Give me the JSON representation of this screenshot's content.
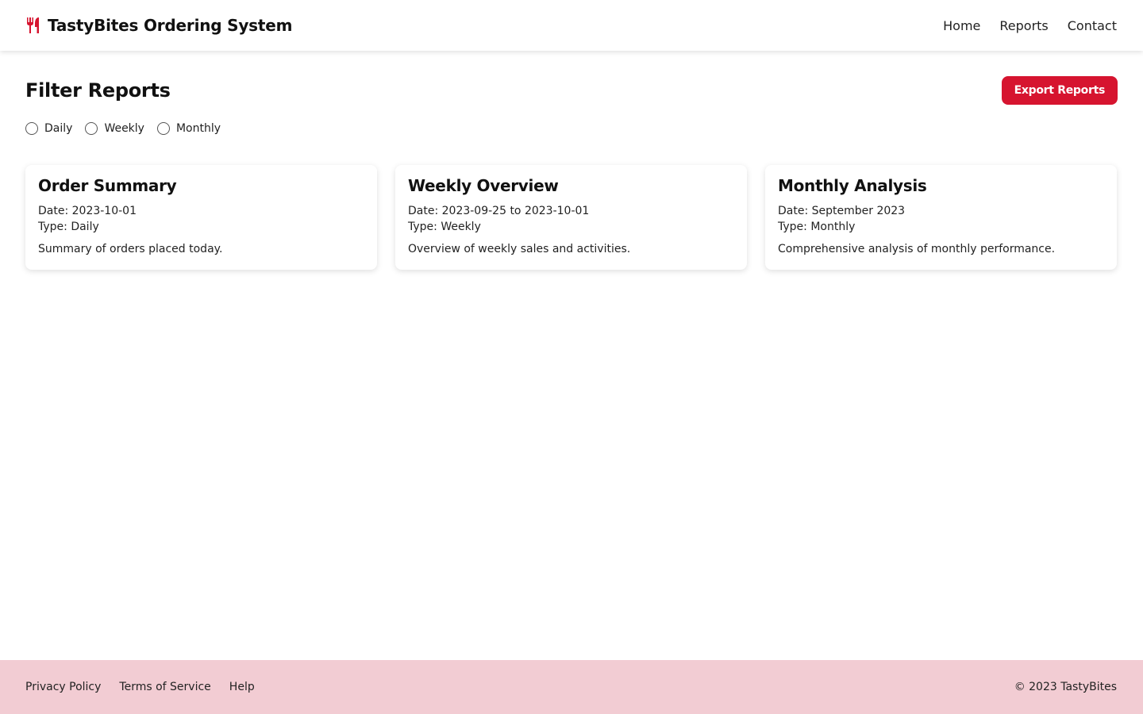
{
  "colors": {
    "accent": "#d6142f",
    "footer_bg": "#f2ccd3",
    "header_bg": "#ffffff"
  },
  "header": {
    "brand_icon": "utensils-icon",
    "title": "TastyBites Ordering System",
    "nav": [
      {
        "label": "Home"
      },
      {
        "label": "Reports"
      },
      {
        "label": "Contact"
      }
    ]
  },
  "toolbar": {
    "title": "Filter Reports",
    "export_label": "Export Reports"
  },
  "filters": {
    "options": [
      {
        "label": "Daily",
        "checked": false
      },
      {
        "label": "Weekly",
        "checked": false
      },
      {
        "label": "Monthly",
        "checked": false
      }
    ]
  },
  "reports": [
    {
      "title": "Order Summary",
      "date": "Date: 2023-10-01",
      "type": "Type: Daily",
      "description": "Summary of orders placed today."
    },
    {
      "title": "Weekly Overview",
      "date": "Date: 2023-09-25 to 2023-10-01",
      "type": "Type: Weekly",
      "description": "Overview of weekly sales and activities."
    },
    {
      "title": "Monthly Analysis",
      "date": "Date: September 2023",
      "type": "Type: Monthly",
      "description": "Comprehensive analysis of monthly performance."
    }
  ],
  "footer": {
    "links": [
      {
        "label": "Privacy Policy"
      },
      {
        "label": "Terms of Service"
      },
      {
        "label": "Help"
      }
    ],
    "copyright": "© 2023 TastyBites"
  }
}
